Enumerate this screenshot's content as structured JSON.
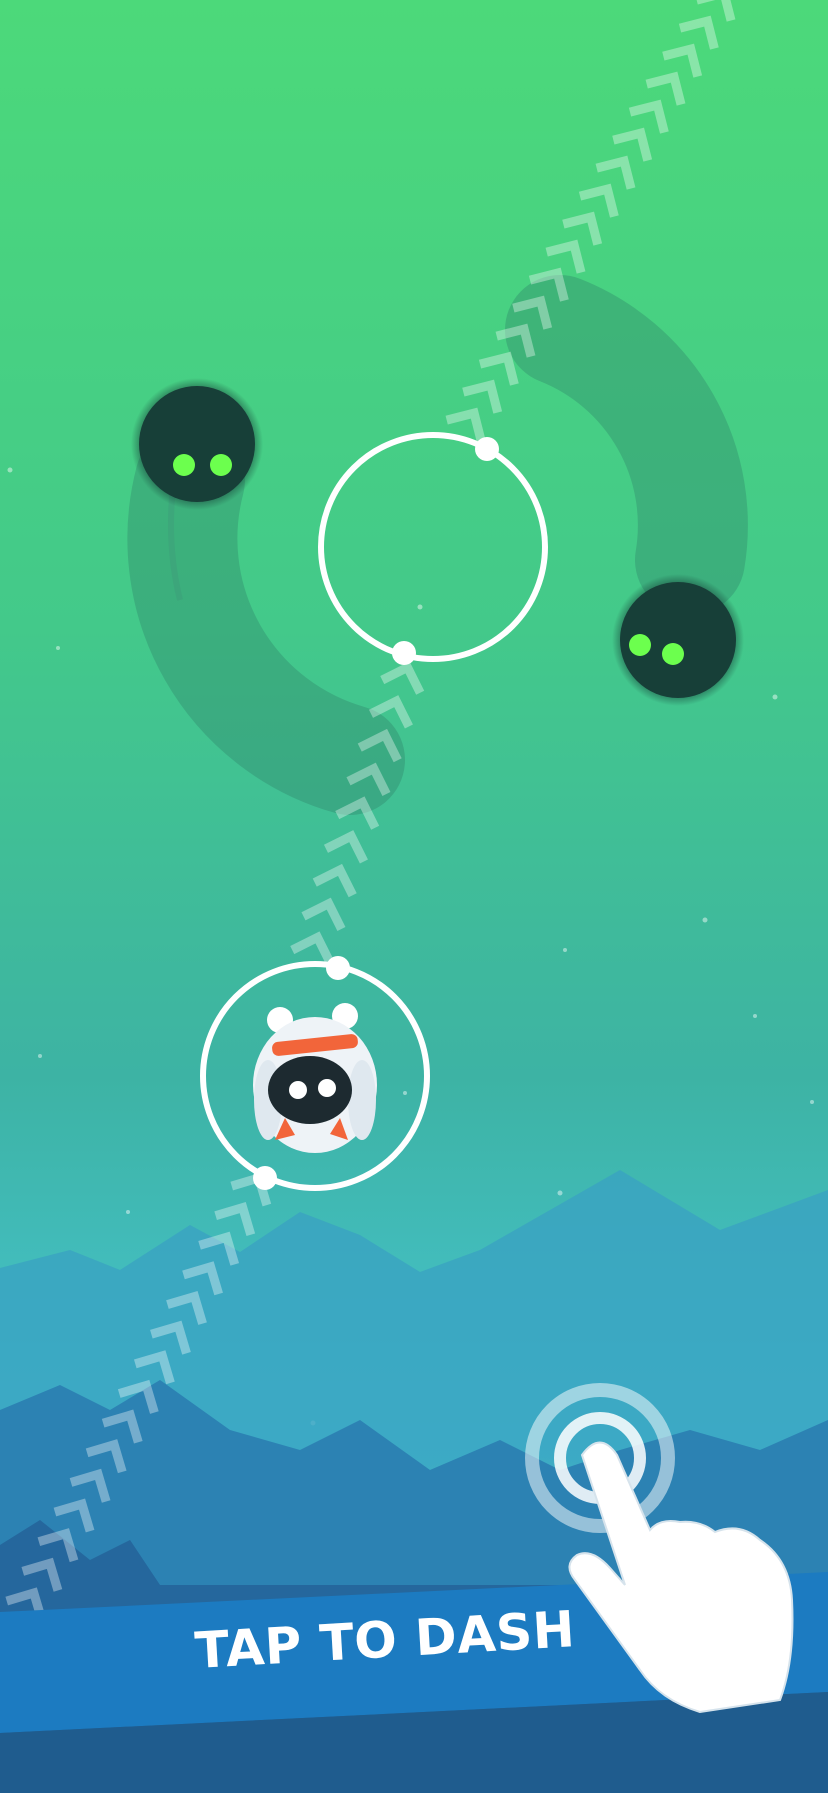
{
  "instruction": {
    "text": "TAP TO DASH"
  },
  "colors": {
    "sky_top": "#4cd97a",
    "sky_mid": "#3fb5a0",
    "sky_bottom": "#4cc9e0",
    "mountain_far": "#3aa4c4",
    "mountain_mid": "#2f86b6",
    "mountain_near": "#2668a0",
    "banner": "#1d7cc2",
    "enemy_eye": "#6cff4e",
    "ring": "#ffffff"
  },
  "icons": {
    "player": "yeti-creature-icon",
    "enemy": "fuzzy-shadow-enemy-icon",
    "hand": "tap-hand-icon",
    "path": "chevron-up-icon"
  }
}
